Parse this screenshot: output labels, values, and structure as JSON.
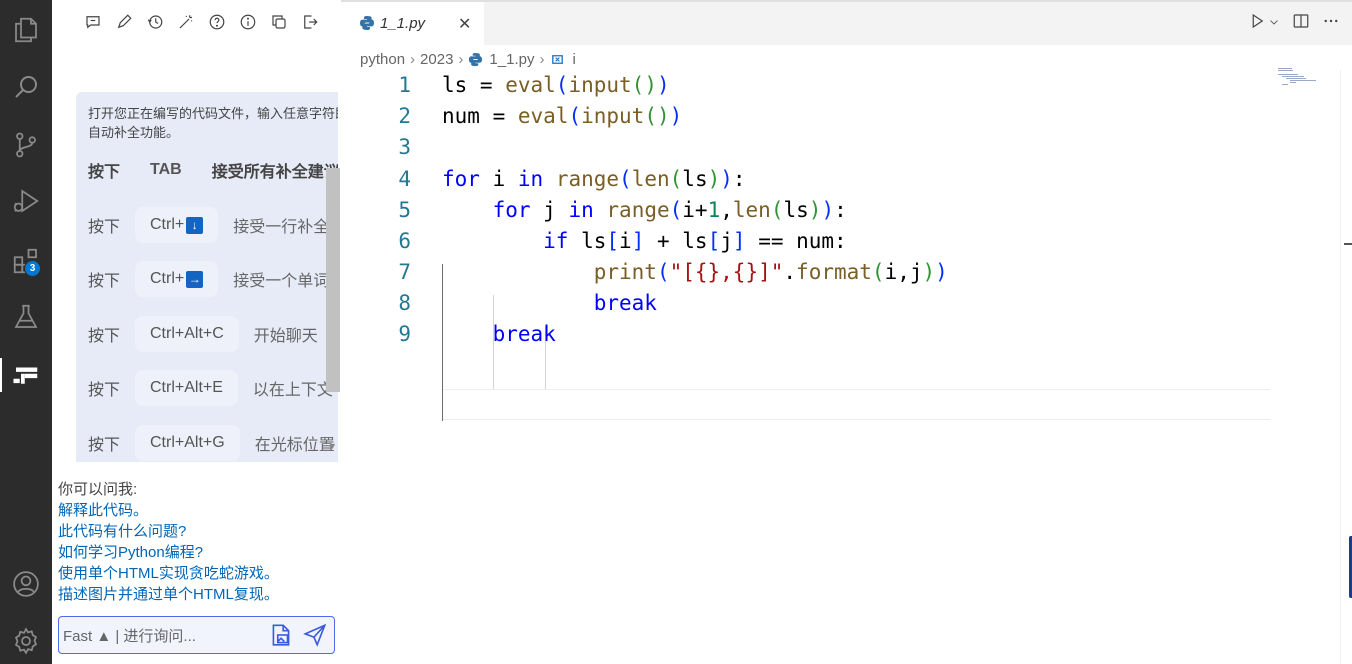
{
  "activity_bar": {
    "items": [
      {
        "name": "explorer-icon"
      },
      {
        "name": "search-icon"
      },
      {
        "name": "source-control-icon"
      },
      {
        "name": "run-debug-icon"
      },
      {
        "name": "extensions-icon",
        "badge": "3"
      },
      {
        "name": "testing-icon"
      },
      {
        "name": "ai-assistant-icon"
      }
    ],
    "bottom": [
      {
        "name": "account-icon"
      },
      {
        "name": "settings-icon"
      }
    ]
  },
  "side_panel": {
    "help_card": {
      "intro": "打开您正在编写的代码文件，输入任意字符即可触发自动补全功能。",
      "shortcuts": [
        {
          "press": "按下",
          "key": "TAB",
          "key_box": "",
          "desc": "接受所有补全建议"
        },
        {
          "press": "按下",
          "key": "Ctrl+",
          "key_box": "↓",
          "desc": "接受一行补全"
        },
        {
          "press": "按下",
          "key": "Ctrl+",
          "key_box": "→",
          "desc": "接受一个单词"
        },
        {
          "press": "按下",
          "key": "Ctrl+Alt+C",
          "key_box": "",
          "desc": "开始聊天"
        },
        {
          "press": "按下",
          "key": "Ctrl+Alt+E",
          "key_box": "",
          "desc": "以在上下文"
        },
        {
          "press": "按下",
          "key": "Ctrl+Alt+G",
          "key_box": "",
          "desc": "在光标位置"
        }
      ]
    },
    "suggestions": {
      "title": "你可以问我:",
      "items": [
        "解释此代码。",
        "此代码有什么问题?",
        "如何学习Python编程?",
        "使用单个HTML实现贪吃蛇游戏。",
        "描述图片并通过单个HTML复现。"
      ]
    },
    "chat_input": {
      "placeholder": "Fast ▲ | 进行询问..."
    }
  },
  "editor": {
    "tab": {
      "label": "1_1.py",
      "close": "✕"
    },
    "breadcrumb": [
      "python",
      "2023",
      "1_1.py",
      "i"
    ],
    "line_numbers": [
      "1",
      "2",
      "3",
      "4",
      "5",
      "6",
      "7",
      "8",
      "9"
    ]
  },
  "colors": {
    "activity_bg": "#2c2c2c",
    "accent": "#0078d4",
    "help_card_bg": "#e7ebf8",
    "link": "#0066b8",
    "keyword": "#0000ff",
    "function": "#795e26",
    "string": "#a31515",
    "number": "#098658"
  }
}
